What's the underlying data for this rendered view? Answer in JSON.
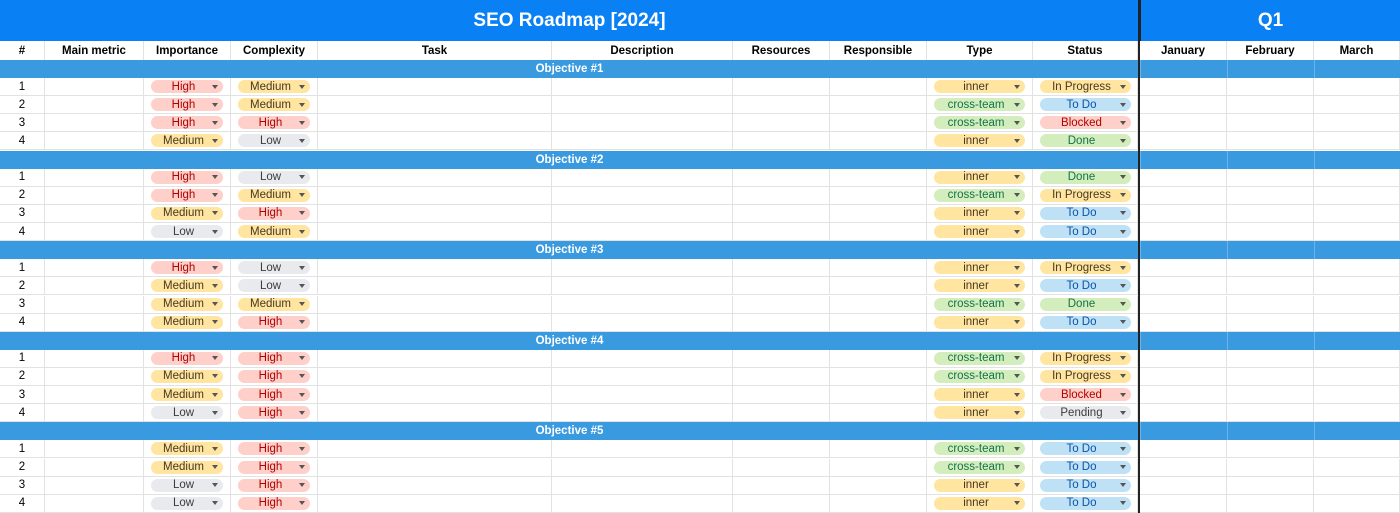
{
  "sheet": {
    "title": "SEO Roadmap [2024]",
    "quarter": "Q1",
    "headers": [
      "#",
      "Main metric",
      "Importance",
      "Complexity",
      "Task",
      "Description",
      "Resources",
      "Responsible",
      "Type",
      "Status",
      "January",
      "February",
      "March"
    ]
  },
  "colors": {
    "title_bg": "#0a80f5",
    "objective_bg": "#3a9ae0",
    "high": {
      "bg": "#ffcfc9",
      "fg": "#b10202"
    },
    "medium": {
      "bg": "#ffe5a0",
      "fg": "#473821"
    },
    "low": {
      "bg": "#e8eaed",
      "fg": "#3c3c3c"
    },
    "inner": {
      "bg": "#ffe5a0",
      "fg": "#473821"
    },
    "cross-team": {
      "bg": "#d4edbc",
      "fg": "#11734b"
    },
    "In Progress": {
      "bg": "#ffe5a0",
      "fg": "#473821"
    },
    "To Do": {
      "bg": "#bfe1f6",
      "fg": "#0a53a8"
    },
    "Blocked": {
      "bg": "#ffcfc9",
      "fg": "#b10202"
    },
    "Done": {
      "bg": "#d4edbc",
      "fg": "#11734b"
    },
    "Pending": {
      "bg": "#e8eaed",
      "fg": "#3c3c3c"
    }
  },
  "objectives": [
    {
      "label": "Objective #1",
      "rows": [
        {
          "num": "1",
          "importance": "High",
          "complexity": "Medium",
          "type": "inner",
          "status": "In Progress"
        },
        {
          "num": "2",
          "importance": "High",
          "complexity": "Medium",
          "type": "cross-team",
          "status": "To Do"
        },
        {
          "num": "3",
          "importance": "High",
          "complexity": "High",
          "type": "cross-team",
          "status": "Blocked"
        },
        {
          "num": "4",
          "importance": "Medium",
          "complexity": "Low",
          "type": "inner",
          "status": "Done"
        }
      ]
    },
    {
      "label": "Objective #2",
      "rows": [
        {
          "num": "1",
          "importance": "High",
          "complexity": "Low",
          "type": "inner",
          "status": "Done"
        },
        {
          "num": "2",
          "importance": "High",
          "complexity": "Medium",
          "type": "cross-team",
          "status": "In Progress"
        },
        {
          "num": "3",
          "importance": "Medium",
          "complexity": "High",
          "type": "inner",
          "status": "To Do"
        },
        {
          "num": "4",
          "importance": "Low",
          "complexity": "Medium",
          "type": "inner",
          "status": "To Do"
        }
      ]
    },
    {
      "label": "Objective #3",
      "rows": [
        {
          "num": "1",
          "importance": "High",
          "complexity": "Low",
          "type": "inner",
          "status": "In Progress"
        },
        {
          "num": "2",
          "importance": "Medium",
          "complexity": "Low",
          "type": "inner",
          "status": "To Do"
        },
        {
          "num": "3",
          "importance": "Medium",
          "complexity": "Medium",
          "type": "cross-team",
          "status": "Done"
        },
        {
          "num": "4",
          "importance": "Medium",
          "complexity": "High",
          "type": "inner",
          "status": "To Do"
        }
      ]
    },
    {
      "label": "Objective #4",
      "rows": [
        {
          "num": "1",
          "importance": "High",
          "complexity": "High",
          "type": "cross-team",
          "status": "In Progress"
        },
        {
          "num": "2",
          "importance": "Medium",
          "complexity": "High",
          "type": "cross-team",
          "status": "In Progress"
        },
        {
          "num": "3",
          "importance": "Medium",
          "complexity": "High",
          "type": "inner",
          "status": "Blocked"
        },
        {
          "num": "4",
          "importance": "Low",
          "complexity": "High",
          "type": "inner",
          "status": "Pending"
        }
      ]
    },
    {
      "label": "Objective #5",
      "rows": [
        {
          "num": "1",
          "importance": "Medium",
          "complexity": "High",
          "type": "cross-team",
          "status": "To Do"
        },
        {
          "num": "2",
          "importance": "Medium",
          "complexity": "High",
          "type": "cross-team",
          "status": "To Do"
        },
        {
          "num": "3",
          "importance": "Low",
          "complexity": "High",
          "type": "inner",
          "status": "To Do"
        },
        {
          "num": "4",
          "importance": "Low",
          "complexity": "High",
          "type": "inner",
          "status": "To Do"
        }
      ]
    }
  ]
}
